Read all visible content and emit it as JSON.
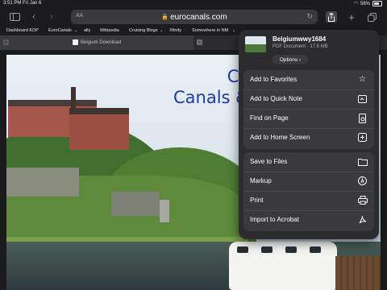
{
  "status_bar": {
    "time": "3:51 PM",
    "date": "Fri Jan 6",
    "battery_percent": "56%",
    "icons": [
      "wifi-icon",
      "battery-icon"
    ]
  },
  "toolbar": {
    "text_size_label": "AA",
    "address": "eurocanals.com",
    "icons": [
      "sidebar-icon",
      "back-icon",
      "forward-icon",
      "reload-icon",
      "share-icon",
      "new-tab-icon",
      "tabs-icon"
    ]
  },
  "favorites": [
    {
      "label": "Dashboard KDP"
    },
    {
      "label": "EuroCanals"
    },
    {
      "label": "ally"
    },
    {
      "label": "Wikipedia"
    },
    {
      "label": "Cruising Blogs"
    },
    {
      "label": "Xfinity"
    },
    {
      "label": "Somewhere in NM"
    }
  ],
  "tabs": [
    {
      "title": "Belgium Download"
    }
  ],
  "page": {
    "title_line1": "Cruisin",
    "title_line2": "Canals & Rive"
  },
  "share_menu": {
    "doc_name": "Belgiumwwy1684",
    "doc_meta": "PDF Document · 17.6 MB",
    "options_label": "Options ›",
    "group1": [
      {
        "label": "Add to Favorites",
        "icon": "star-icon"
      },
      {
        "label": "Add to Quick Note",
        "icon": "quick-note-icon"
      },
      {
        "label": "Find on Page",
        "icon": "find-icon"
      },
      {
        "label": "Add to Home Screen",
        "icon": "add-square-icon"
      }
    ],
    "group2": [
      {
        "label": "Save to Files",
        "icon": "folder-icon"
      },
      {
        "label": "Markup",
        "icon": "markup-icon"
      },
      {
        "label": "Print",
        "icon": "printer-icon"
      },
      {
        "label": "Import to Acrobat",
        "icon": "acrobat-icon"
      }
    ]
  }
}
